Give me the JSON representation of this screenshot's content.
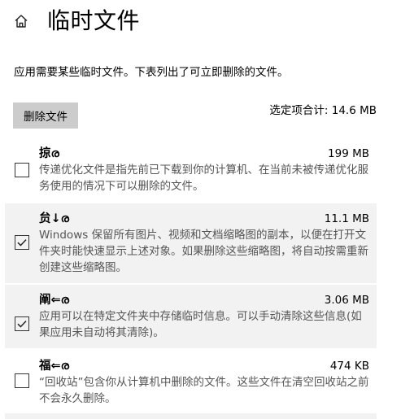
{
  "header": {
    "title": "临时文件",
    "home_icon": "home-icon"
  },
  "description": "应用需要某些临时文件。下表列出了可立即删除的文件。",
  "actions": {
    "delete_label": "删除文件",
    "total_label": "选定项合计: 14.6 MB"
  },
  "items": [
    {
      "name": "掠ര",
      "size": "199 MB",
      "checked": false,
      "description": "传递优化文件是指先前已下载到你的计算机、在当前未被传递优化服务使用的情况下可以删除的文件。"
    },
    {
      "name": "贠↓ര",
      "size": "11.1 MB",
      "checked": true,
      "description": "Windows 保留所有图片、视频和文档缩略图的副本，以便在打开文件夹时能快速显示上述对象。如果删除这些缩略图，将自动按需重新创建这些缩略图。"
    },
    {
      "name": "阐⇐ര",
      "size": "3.06 MB",
      "checked": true,
      "description": "应用可以在特定文件夹中存储临时信息。可以手动清除这些信息(如果应用未自动将其清除)。"
    },
    {
      "name": "福⇐ര",
      "size": "474 KB",
      "checked": false,
      "description": "“回收站”包含你从计算机中删除的文件。这些文件在清空回收站之前不会永久删除。"
    }
  ],
  "colors": {
    "checked_bg": "#f2f2f2",
    "button_bg": "#cccccc",
    "desc_text": "#555555"
  }
}
